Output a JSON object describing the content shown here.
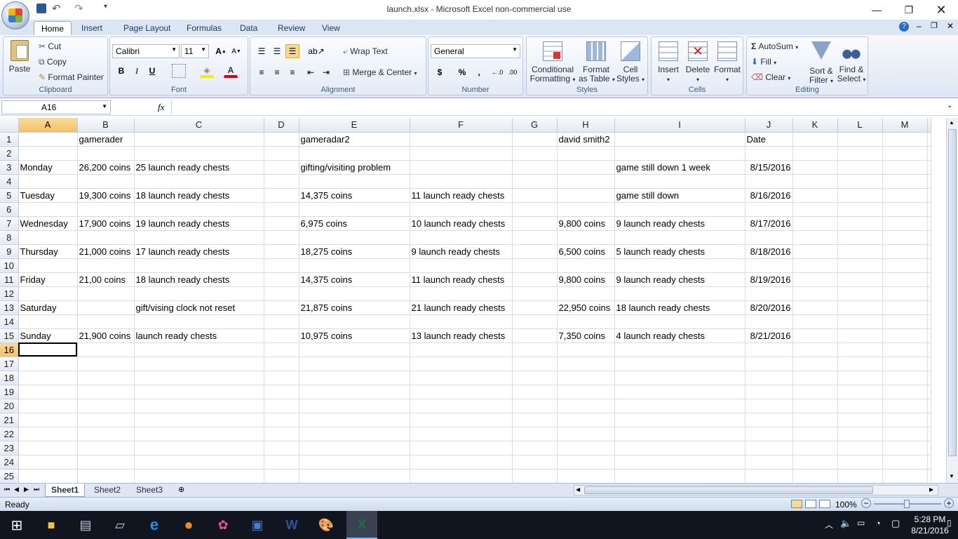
{
  "window": {
    "title": "launch.xlsx - Microsoft Excel non-commercial use"
  },
  "qat": {
    "undo": "↶",
    "redo": "↷"
  },
  "tabs": [
    "Home",
    "Insert",
    "Page Layout",
    "Formulas",
    "Data",
    "Review",
    "View"
  ],
  "ribbon": {
    "clipboard": {
      "label": "Clipboard",
      "paste": "Paste",
      "cut": "Cut",
      "copy": "Copy",
      "format_painter": "Format Painter"
    },
    "font": {
      "label": "Font",
      "name": "Calibri",
      "size": "11",
      "bold": "B",
      "italic": "I",
      "underline": "U"
    },
    "alignment": {
      "label": "Alignment",
      "wrap": "Wrap Text",
      "merge": "Merge & Center"
    },
    "number": {
      "label": "Number",
      "format": "General",
      "currency": "$",
      "percent": "%",
      "comma": ","
    },
    "styles": {
      "label": "Styles",
      "conditional": "Conditional",
      "conditional2": "Formatting",
      "format_table": "Format",
      "format_table2": "as Table",
      "cell_styles": "Cell",
      "cell_styles2": "Styles"
    },
    "cells": {
      "label": "Cells",
      "insert": "Insert",
      "delete": "Delete",
      "format": "Format"
    },
    "editing": {
      "label": "Editing",
      "autosum": "AutoSum",
      "fill": "Fill",
      "clear": "Clear",
      "sort": "Sort &",
      "sort2": "Filter",
      "find": "Find &",
      "find2": "Select"
    }
  },
  "formula_bar": {
    "name_box": "A16",
    "fx": "fx",
    "formula": ""
  },
  "columns": [
    "A",
    "B",
    "C",
    "D",
    "E",
    "F",
    "G",
    "H",
    "I",
    "J",
    "K",
    "L",
    "M"
  ],
  "rows": [
    [
      "",
      "gamerader",
      "",
      "",
      "gameradar2",
      "",
      "",
      "david smith2",
      "",
      "Date",
      "",
      "",
      ""
    ],
    [
      "",
      "",
      "",
      "",
      "",
      "",
      "",
      "",
      "",
      "",
      "",
      "",
      ""
    ],
    [
      "Monday",
      "26,200 coins",
      "25 launch ready chests",
      "",
      "gifting/visiting problem",
      "",
      "",
      "",
      "game still down 1 week",
      "8/15/2016",
      "",
      "",
      ""
    ],
    [
      "",
      "",
      "",
      "",
      "",
      "",
      "",
      "",
      "",
      "",
      "",
      "",
      ""
    ],
    [
      "Tuesday",
      "19,300 coins",
      "18 launch ready chests",
      "",
      "14,375 coins",
      "11 launch ready chests",
      "",
      "",
      "game still down",
      "8/16/2016",
      "",
      "",
      ""
    ],
    [
      "",
      "",
      "",
      "",
      "",
      "",
      "",
      "",
      "",
      "",
      "",
      "",
      ""
    ],
    [
      "Wednesday",
      "17,900 coins",
      "19 launch ready chests",
      "",
      "6,975 coins",
      "10 launch ready chests",
      "",
      "9,800 coins",
      "9 launch ready chests",
      "8/17/2016",
      "",
      "",
      ""
    ],
    [
      "",
      "",
      "",
      "",
      "",
      "",
      "",
      "",
      "",
      "",
      "",
      "",
      ""
    ],
    [
      "Thursday",
      "21,000 coins",
      "17 launch ready chests",
      "",
      "18,275 coins",
      "9 launch ready chests",
      "",
      "6,500 coins",
      "5 launch ready chests",
      "8/18/2016",
      "",
      "",
      ""
    ],
    [
      "",
      "",
      "",
      "",
      "",
      "",
      "",
      "",
      "",
      "",
      "",
      "",
      ""
    ],
    [
      "Friday",
      "21,00 coins",
      "18 launch ready chests",
      "",
      "14,375 coins",
      "11 launch ready chests",
      "",
      "9,800 coins",
      "9 launch ready chests",
      "8/19/2016",
      "",
      "",
      ""
    ],
    [
      "",
      "",
      "",
      "",
      "",
      "",
      "",
      "",
      "",
      "",
      "",
      "",
      ""
    ],
    [
      "Saturday",
      "",
      "gift/vising clock not reset",
      "",
      "21,875 coins",
      "21 launch ready chests",
      "",
      "22,950 coins",
      "18 launch ready chests",
      "8/20/2016",
      "",
      "",
      ""
    ],
    [
      "",
      "",
      "",
      "",
      "",
      "",
      "",
      "",
      "",
      "",
      "",
      "",
      ""
    ],
    [
      "Sunday",
      "21,900 coins",
      "launch ready chests",
      "",
      "10,975 coins",
      "13 launch ready chests",
      "",
      "7,350 coins",
      "4 launch ready chests",
      "8/21/2016",
      "",
      "",
      ""
    ]
  ],
  "row_count": 25,
  "sheets": [
    "Sheet1",
    "Sheet2",
    "Sheet3"
  ],
  "status": {
    "ready": "Ready",
    "zoom": "100%"
  },
  "taskbar": {
    "time": "5:28 PM",
    "date": "8/21/2016"
  }
}
